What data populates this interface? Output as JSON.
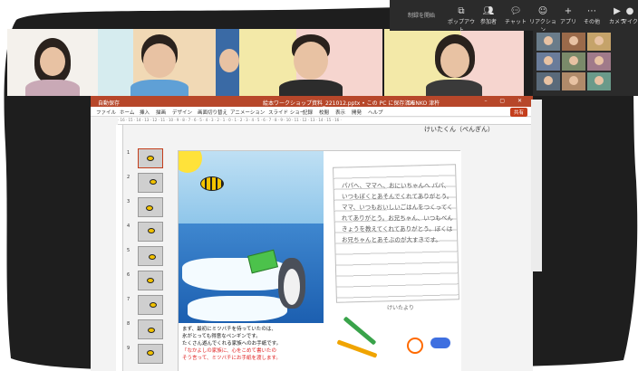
{
  "teams_toolbar": {
    "record_label": "制録を開始",
    "buttons": [
      {
        "label": "ポップアウト",
        "icon": "popout-icon"
      },
      {
        "label": "参加者",
        "icon": "people-icon"
      },
      {
        "label": "チャット",
        "icon": "chat-icon"
      },
      {
        "label": "リアクション",
        "icon": "reaction-icon"
      },
      {
        "label": "アプリ",
        "icon": "apps-icon"
      },
      {
        "label": "その他",
        "icon": "more-icon"
      },
      {
        "label": "カメラ",
        "icon": "camera-icon"
      },
      {
        "label": "マイク",
        "icon": "mic-icon"
      }
    ]
  },
  "powerpoint": {
    "autosave": "自動保存",
    "title": "絵本ワークショップ資料_221012.pptx • この PC に保存済み",
    "user": "DENKO 津杵",
    "menu": [
      "ファイル",
      "ホーム",
      "挿入",
      "描画",
      "デザイン",
      "画面切り替え",
      "アニメーション",
      "スライド ショー",
      "記録",
      "校閲",
      "表示",
      "開発",
      "ヘルプ"
    ],
    "share_label": "共有",
    "ruler_text": "· 16 · 15 · 14 · 13 · 12 · 11 · 10 · 9 · 8 · 7 · 6 · 5 · 4 · 3 · 2 · 1 · 0 · 1 · 2 · 3 · 4 · 5 · 6 · 7 · 8 · 9 · 10 · 11 · 12 · 13 · 14 · 15 · 16 ·",
    "thumbnails": [
      "1",
      "2",
      "3",
      "4",
      "5",
      "6",
      "7",
      "8",
      "9"
    ],
    "slide": {
      "name_label": "けいたくん（ぺんぎん）",
      "letter_text": "パパへ、ママへ、おにいちゃんへ\nパパ、いつもぼくとあそんでくれてありがとう。ママ、いつもおいしいごはんをつくってくれてありがとう。お兄ちゃん、いつもべんきょうを教えてくれてありがとう。ぼくはお兄ちゃんとあそぶのが大すきです。",
      "signature": "けいたより",
      "caption_lines": [
        "まず、最初にミツバチを待っていたのは、",
        "氷がとっても得意なペンギンです。",
        "たくさん遊んでくれる家族へのお手紙です。"
      ],
      "caption_red_lines": [
        "「なかよしの家族に、心をこめて書いたの",
        "そう言って、ミツバチにお手紙を渡します。"
      ]
    }
  },
  "colors": {
    "ppt_accent": "#b7472a",
    "teams_dark": "#2b2b2b",
    "active_tile": "#6b6df0"
  }
}
